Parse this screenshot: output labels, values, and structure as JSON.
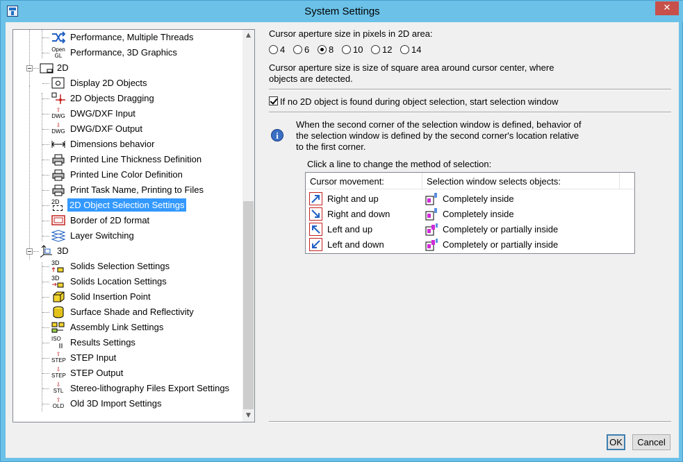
{
  "window": {
    "title": "System Settings",
    "close_glyph": "✕"
  },
  "tree": {
    "items": [
      {
        "label": "Performance, Multiple Threads",
        "icon": "threads-icon",
        "level": 2
      },
      {
        "label": "Performance, 3D Graphics",
        "icon": "opengl-icon",
        "level": 2,
        "icon_text": [
          "Open",
          "GL"
        ]
      },
      {
        "label": "2D",
        "icon": "2d-folder-icon",
        "level": 1,
        "expanded": true
      },
      {
        "label": "Display 2D Objects",
        "icon": "display-2d-icon",
        "level": 2
      },
      {
        "label": "2D Objects Dragging",
        "icon": "drag-icon",
        "level": 2
      },
      {
        "label": "DWG/DXF Input",
        "icon": "dwg-input-icon",
        "level": 2,
        "icon_text": [
          "DWG"
        ]
      },
      {
        "label": "DWG/DXF Output",
        "icon": "dwg-output-icon",
        "level": 2,
        "icon_text": [
          "DWG"
        ]
      },
      {
        "label": "Dimensions behavior",
        "icon": "dimension-icon",
        "level": 2
      },
      {
        "label": "Printed Line Thickness Definition",
        "icon": "printer-icon",
        "level": 2
      },
      {
        "label": "Printed Line Color Definition",
        "icon": "printer-color-icon",
        "level": 2
      },
      {
        "label": "Print Task Name, Printing to Files",
        "icon": "printer-file-icon",
        "level": 2
      },
      {
        "label": "2D Object Selection Settings",
        "icon": "selection-2d-icon",
        "level": 2,
        "selected": true,
        "icon_text": [
          "2D"
        ]
      },
      {
        "label": "Border of 2D format",
        "icon": "border-icon",
        "level": 2
      },
      {
        "label": "Layer Switching",
        "icon": "layers-icon",
        "level": 2
      },
      {
        "label": "3D",
        "icon": "3d-axes-icon",
        "level": 1,
        "expanded": true
      },
      {
        "label": "Solids Selection Settings",
        "icon": "solid-selection-icon",
        "level": 2,
        "icon_text": [
          "3D"
        ]
      },
      {
        "label": "Solids Location Settings",
        "icon": "solid-location-icon",
        "level": 2,
        "icon_text": [
          "3D"
        ]
      },
      {
        "label": "Solid Insertion Point",
        "icon": "cube-icon",
        "level": 2
      },
      {
        "label": "Surface Shade and Reflectivity",
        "icon": "cylinder-icon",
        "level": 2
      },
      {
        "label": "Assembly Link Settings",
        "icon": "assembly-link-icon",
        "level": 2
      },
      {
        "label": "Results Settings",
        "icon": "iso-results-icon",
        "level": 2,
        "icon_text": [
          "ISO"
        ]
      },
      {
        "label": "STEP Input",
        "icon": "step-input-icon",
        "level": 2,
        "icon_text": [
          "STEP"
        ]
      },
      {
        "label": "STEP Output",
        "icon": "step-output-icon",
        "level": 2,
        "icon_text": [
          "STEP"
        ]
      },
      {
        "label": "Stereo-lithography Files Export Settings",
        "icon": "stl-export-icon",
        "level": 2,
        "icon_text": [
          "STL"
        ]
      },
      {
        "label": "Old 3D Import Settings",
        "icon": "old-import-icon",
        "level": 2,
        "icon_text": [
          "OLD"
        ]
      }
    ]
  },
  "panel": {
    "aperture_label": "Cursor aperture size in pixels in 2D area:",
    "aperture_options": [
      "4",
      "6",
      "8",
      "10",
      "12",
      "14"
    ],
    "aperture_selected": "8",
    "aperture_desc_1": "Cursor aperture size is size of square area around cursor center, where",
    "aperture_desc_2": "objects are detected.",
    "window_checkbox_label": "If no 2D object is found during object selection, start selection window",
    "window_checkbox_checked": true,
    "info_1": "When the second corner of the selection window is defined, behavior of",
    "info_2": "the selection window is defined by the second corner's location relative",
    "info_3": "to the first corner.",
    "click_hint": "Click a line to change the method of selection:",
    "table": {
      "headers": [
        "Cursor movement:",
        "Selection window selects objects:"
      ],
      "rows": [
        {
          "movement": "Right and up",
          "direction": "up-right",
          "selects": "Completely inside"
        },
        {
          "movement": "Right and down",
          "direction": "down-right",
          "selects": "Completely inside"
        },
        {
          "movement": "Left and up",
          "direction": "up-left",
          "selects": "Completely or partially inside"
        },
        {
          "movement": "Left and down",
          "direction": "down-left",
          "selects": "Completely or partially inside"
        }
      ]
    }
  },
  "buttons": {
    "ok": "OK",
    "cancel": "Cancel"
  },
  "colors": {
    "selection": "#3399ff",
    "title_bar": "#6bc1e7",
    "close": "#c7504a",
    "arrow_red": "#c2211f",
    "arrow_blue": "#1f5fc4"
  }
}
